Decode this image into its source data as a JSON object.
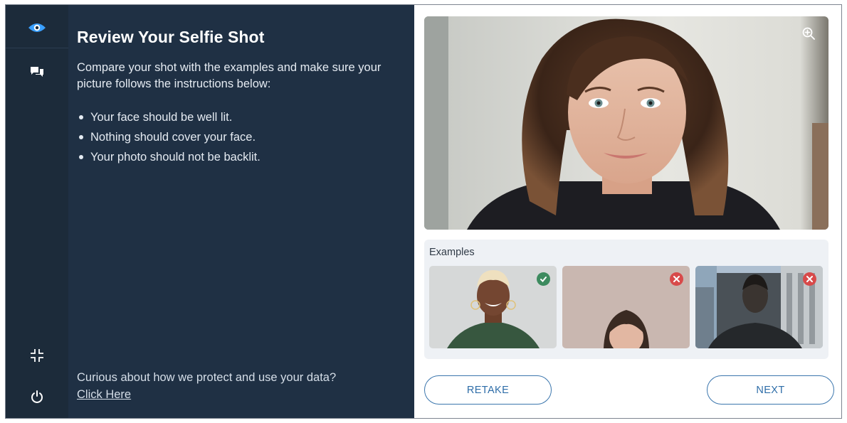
{
  "rail": {
    "items": [
      {
        "icon": "eye-icon"
      },
      {
        "icon": "chat-icon"
      },
      {
        "icon": "collapse-icon"
      },
      {
        "icon": "power-icon"
      }
    ],
    "accent": "#3aa0ff"
  },
  "review": {
    "title": "Review Your Selfie Shot",
    "intro": "Compare your shot with the examples and make sure your picture follows the instructions below:",
    "instructions": [
      "Your face should be well lit.",
      "Nothing should cover your face.",
      "Your photo should not be backlit."
    ],
    "privacy_text": "Curious about how we protect and use your data?",
    "privacy_link": "Click Here"
  },
  "photo": {
    "zoom_icon": "zoom-in-icon"
  },
  "examples": {
    "label": "Examples",
    "items": [
      {
        "status": "valid",
        "icon": "check-icon",
        "color": "#3d8b5f"
      },
      {
        "status": "invalid",
        "icon": "close-icon",
        "color": "#d84a4a"
      },
      {
        "status": "invalid",
        "icon": "close-icon",
        "color": "#d84a4a"
      }
    ]
  },
  "actions": {
    "retake_label": "RETAKE",
    "next_label": "NEXT"
  }
}
